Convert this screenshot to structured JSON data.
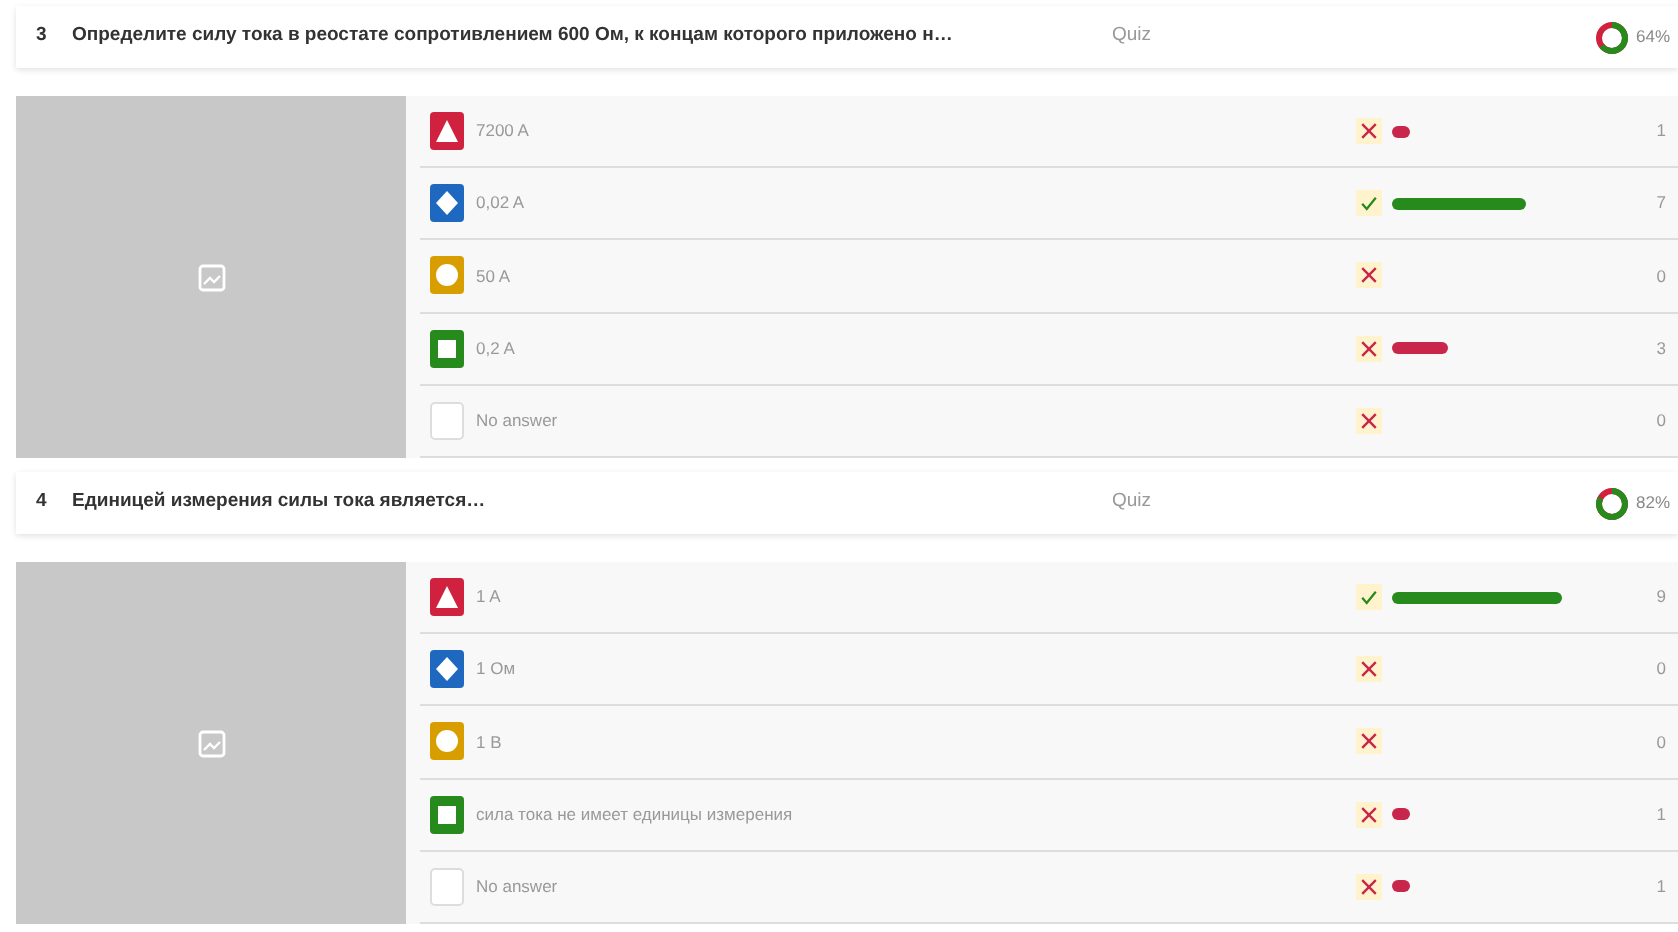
{
  "questions": [
    {
      "number": "3",
      "text": "Определите силу тока в реостате сопротивлением 600 Ом, к концам которого приложено н…",
      "type": "Quiz",
      "score": "64%",
      "level": 0.64,
      "answers": [
        {
          "kind": "triangle",
          "color": "#d0213f",
          "text": "7200 A",
          "correct": false,
          "level": 0.09,
          "count": "1"
        },
        {
          "kind": "diamond",
          "color": "#1f68c0",
          "text": "0,02 A",
          "correct": true,
          "level": 0.64,
          "count": "7"
        },
        {
          "kind": "circle",
          "color": "#d89e00",
          "text": "50 A",
          "correct": false,
          "count": "0"
        },
        {
          "kind": "square",
          "color": "#268a1c",
          "text": "0,2 A",
          "correct": false,
          "level": 0.27,
          "count": "3"
        },
        {
          "kind": "none",
          "text": "No answer",
          "correct": false,
          "count": "0"
        }
      ]
    },
    {
      "number": "4",
      "text": "Единицей измерения силы тока является…",
      "type": "Quiz",
      "score": "82%",
      "level": 0.82,
      "answers": [
        {
          "kind": "triangle",
          "color": "#d0213f",
          "text": "1 A",
          "correct": true,
          "level": 0.82,
          "count": "9"
        },
        {
          "kind": "diamond",
          "color": "#1f68c0",
          "text": "1 Ом",
          "correct": false,
          "count": "0"
        },
        {
          "kind": "circle",
          "color": "#d89e00",
          "text": "1 В",
          "correct": false,
          "count": "0"
        },
        {
          "kind": "square",
          "color": "#268a1c",
          "text": "сила тока не имеет единицы измерения",
          "correct": false,
          "level": 0.09,
          "count": "1"
        },
        {
          "kind": "none",
          "text": "No answer",
          "correct": false,
          "level": 0.09,
          "count": "1"
        }
      ]
    }
  ]
}
